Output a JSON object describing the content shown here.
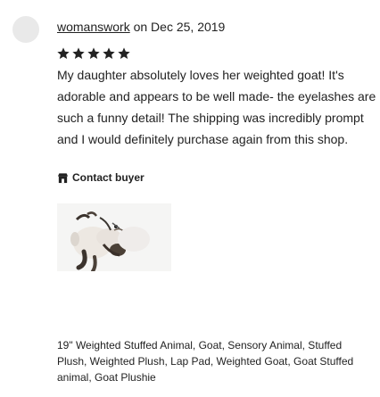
{
  "review": {
    "reviewer": "womanswork",
    "date_text": " on Dec 25, 2019",
    "rating": 5,
    "rating_max": 5,
    "star_color": "#222222",
    "text": "My daughter absolutely loves her weighted goat! It's adorable and appears to be well made- the eyelashes are such a funny detail! The shipping was incredibly prompt and I would definitely purchase again from this shop.",
    "contact_label": "Contact buyer",
    "contact_icon": "shop-icon",
    "product": {
      "image_icon": "goat-plushie-photo",
      "title": "19\" Weighted Stuffed Animal, Goat, Sensory Animal, Stuffed Plush, Weighted Plush, Lap Pad, Weighted Goat, Goat Stuffed animal, Goat Plushie"
    }
  }
}
